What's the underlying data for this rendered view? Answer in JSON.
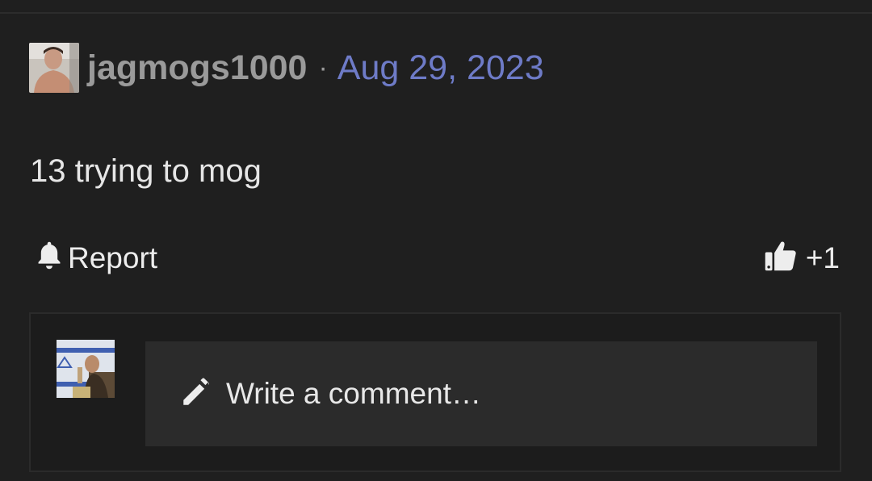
{
  "post": {
    "username": "jagmogs1000",
    "separator": "·",
    "date": "Aug 29, 2023",
    "body": "13 trying to mog"
  },
  "actions": {
    "report_label": "Report",
    "report_icon": "bell-icon",
    "reaction_icon": "thumbs-up-icon",
    "reaction_count": "+1"
  },
  "comment": {
    "placeholder": "Write a comment…",
    "icon": "pencil-icon"
  },
  "colors": {
    "background": "#1f1f1f",
    "username": "#9a9a9a",
    "date_link": "#6e7bc7",
    "text": "#e6e6e6",
    "comment_field": "#2b2b2b"
  }
}
